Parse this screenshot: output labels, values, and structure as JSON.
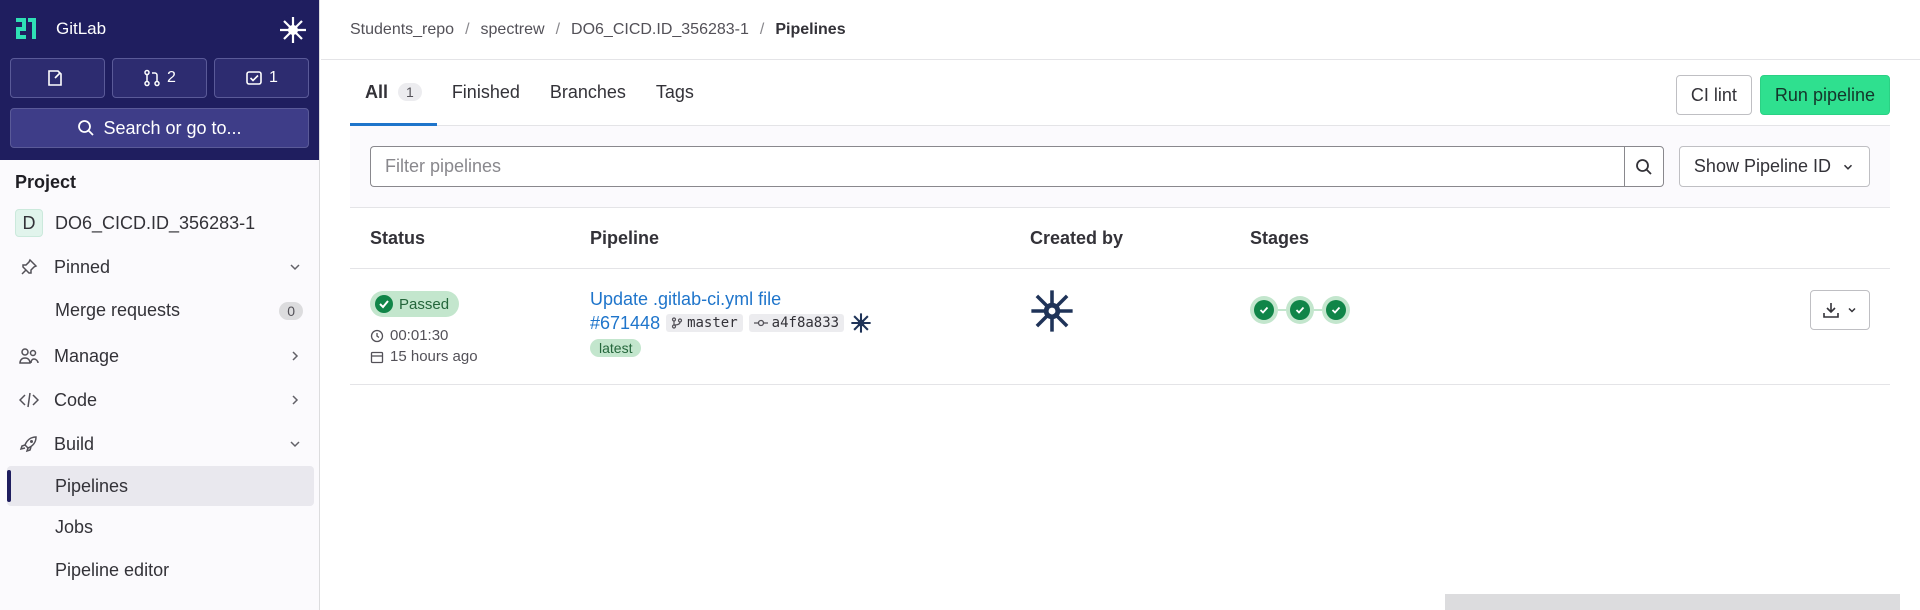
{
  "sidebar": {
    "brand": "GitLab",
    "counters": {
      "issues": "",
      "merge_requests": "2",
      "todos": "1"
    },
    "search_label": "Search or go to...",
    "section_title": "Project",
    "project_initial": "D",
    "project_name": "DO6_CICD.ID_356283-1",
    "items": {
      "pinned": "Pinned",
      "merge_requests": "Merge requests",
      "merge_requests_count": "0",
      "manage": "Manage",
      "code": "Code",
      "build": "Build",
      "pipelines": "Pipelines",
      "jobs": "Jobs",
      "pipeline_editor": "Pipeline editor"
    }
  },
  "breadcrumb": {
    "items": [
      "Students_repo",
      "spectrew",
      "DO6_CICD.ID_356283-1"
    ],
    "current": "Pipelines"
  },
  "tabs": {
    "all": "All",
    "all_count": "1",
    "finished": "Finished",
    "branches": "Branches",
    "tags": "Tags"
  },
  "actions": {
    "ci_lint": "CI lint",
    "run_pipeline": "Run pipeline"
  },
  "filter": {
    "placeholder": "Filter pipelines",
    "show_id": "Show Pipeline ID"
  },
  "table": {
    "headers": {
      "status": "Status",
      "pipeline": "Pipeline",
      "created_by": "Created by",
      "stages": "Stages"
    },
    "rows": [
      {
        "status": "Passed",
        "duration": "00:01:30",
        "finished": "15 hours ago",
        "title": "Update .gitlab-ci.yml file",
        "id": "#671448",
        "branch": "master",
        "commit": "a4f8a833",
        "tag": "latest",
        "stages": [
          "success",
          "success",
          "success"
        ]
      }
    ]
  },
  "colors": {
    "sidebar_top": "#1f1e5f",
    "accent_link": "#1f75cb",
    "confirm": "#2fe08f",
    "success": "#108548"
  }
}
